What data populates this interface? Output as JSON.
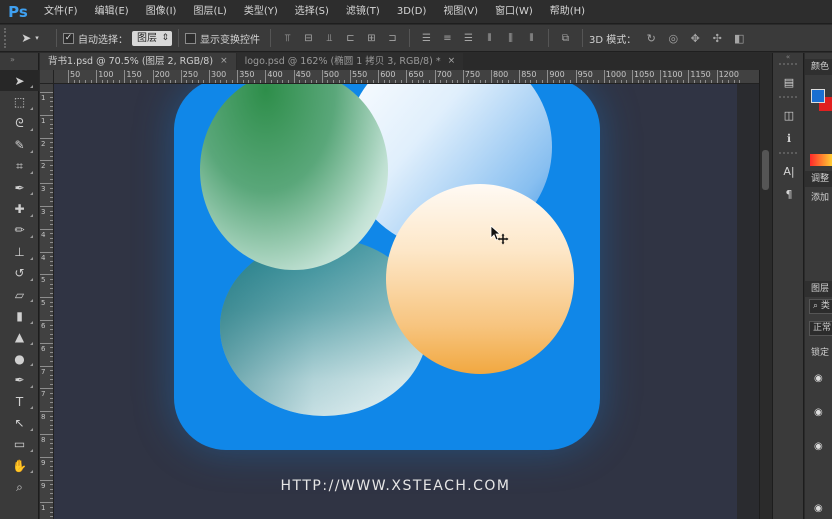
{
  "app": {
    "logo": "Ps"
  },
  "menu": [
    "文件(F)",
    "编辑(E)",
    "图像(I)",
    "图层(L)",
    "类型(Y)",
    "选择(S)",
    "滤镜(T)",
    "3D(D)",
    "视图(V)",
    "窗口(W)",
    "帮助(H)"
  ],
  "options": {
    "auto_select_label": "自动选择：",
    "auto_select_checked": "✓",
    "layer_select_value": "图层",
    "show_transform_label": "显示变换控件",
    "mode3d_label": "3D 模式："
  },
  "tabs": [
    {
      "label": "背书1.psd @ 70.5% (图层 2, RGB/8)",
      "active": true
    },
    {
      "label": "logo.psd @ 162% (椭圆 1 拷贝 3, RGB/8) *",
      "active": false
    }
  ],
  "tab_close": "×",
  "ruler_top_labels": [
    "50",
    "100",
    "150",
    "200",
    "250",
    "300",
    "350",
    "400",
    "450",
    "500",
    "550",
    "600",
    "650",
    "700",
    "750",
    "800",
    "850",
    "900",
    "950",
    "1000",
    "1050",
    "1100",
    "1150",
    "1200"
  ],
  "ruler_left_labels": [
    "1",
    "1",
    "2",
    "2",
    "3",
    "3",
    "4",
    "4",
    "5",
    "5",
    "6",
    "6",
    "7",
    "7",
    "8",
    "8",
    "9",
    "9",
    "1"
  ],
  "canvas": {
    "url_text": "HTTP://WWW.XSTEACH.COM",
    "icon_color": "#1087e8",
    "background_color": "#303444"
  },
  "tools": [
    "move-tool",
    "marquee-tool",
    "lasso-tool",
    "quick-select-tool",
    "crop-tool",
    "eyedropper-tool",
    "healing-brush-tool",
    "brush-tool",
    "clone-stamp-tool",
    "history-brush-tool",
    "eraser-tool",
    "gradient-tool",
    "blur-tool",
    "dodge-tool",
    "pen-tool",
    "type-tool",
    "path-select-tool",
    "rectangle-tool",
    "hand-tool",
    "zoom-tool"
  ],
  "panels": {
    "color_tab": "颜色",
    "adjust_tab": "调整",
    "adjust_add": "添加",
    "layers_tab": "图层",
    "layers_kind": "类",
    "layers_mode": "正常",
    "layers_lock": "锁定",
    "swatch_fg": "#1a6fd2",
    "swatch_bg": "#e02020"
  },
  "glyphs": {
    "move": "➤",
    "marquee": "⬚",
    "lasso": "ᘓ",
    "quick_select": "✎",
    "crop": "⌗",
    "eyedropper": "✒",
    "healing": "✚",
    "brush": "✏",
    "stamp": "⊥",
    "history": "↺",
    "eraser": "▱",
    "gradient": "▮",
    "blur": "▲",
    "dodge": "●",
    "pen": "✒",
    "type": "T",
    "path": "↖",
    "rect": "▭",
    "hand": "✋",
    "zoom": "⌕",
    "eye": "👁",
    "info": "ℹ",
    "para": "¶",
    "char": "A|",
    "search": "⌕"
  }
}
